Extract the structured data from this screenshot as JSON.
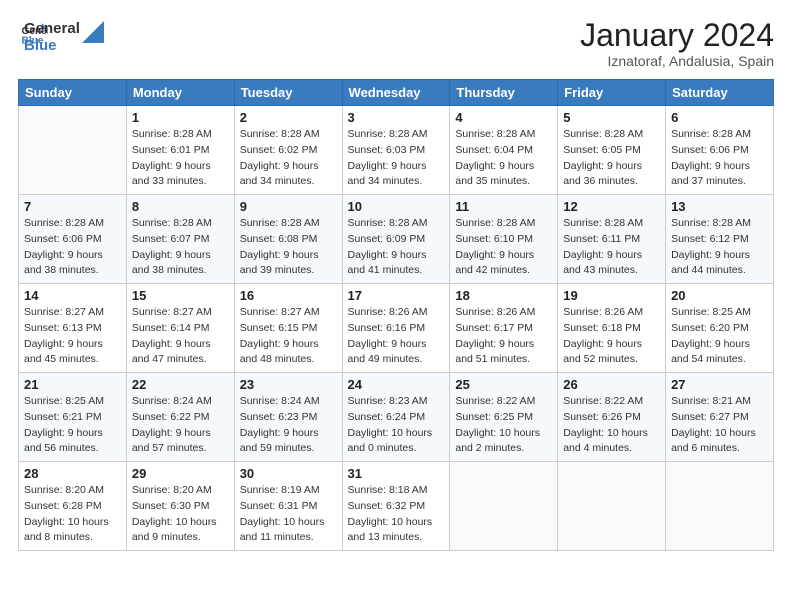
{
  "header": {
    "logo_general": "General",
    "logo_blue": "Blue",
    "month_title": "January 2024",
    "subtitle": "Iznatoraf, Andalusia, Spain"
  },
  "weekdays": [
    "Sunday",
    "Monday",
    "Tuesday",
    "Wednesday",
    "Thursday",
    "Friday",
    "Saturday"
  ],
  "weeks": [
    [
      {
        "day": "",
        "info": ""
      },
      {
        "day": "1",
        "info": "Sunrise: 8:28 AM\nSunset: 6:01 PM\nDaylight: 9 hours\nand 33 minutes."
      },
      {
        "day": "2",
        "info": "Sunrise: 8:28 AM\nSunset: 6:02 PM\nDaylight: 9 hours\nand 34 minutes."
      },
      {
        "day": "3",
        "info": "Sunrise: 8:28 AM\nSunset: 6:03 PM\nDaylight: 9 hours\nand 34 minutes."
      },
      {
        "day": "4",
        "info": "Sunrise: 8:28 AM\nSunset: 6:04 PM\nDaylight: 9 hours\nand 35 minutes."
      },
      {
        "day": "5",
        "info": "Sunrise: 8:28 AM\nSunset: 6:05 PM\nDaylight: 9 hours\nand 36 minutes."
      },
      {
        "day": "6",
        "info": "Sunrise: 8:28 AM\nSunset: 6:06 PM\nDaylight: 9 hours\nand 37 minutes."
      }
    ],
    [
      {
        "day": "7",
        "info": "Sunrise: 8:28 AM\nSunset: 6:06 PM\nDaylight: 9 hours\nand 38 minutes."
      },
      {
        "day": "8",
        "info": "Sunrise: 8:28 AM\nSunset: 6:07 PM\nDaylight: 9 hours\nand 38 minutes."
      },
      {
        "day": "9",
        "info": "Sunrise: 8:28 AM\nSunset: 6:08 PM\nDaylight: 9 hours\nand 39 minutes."
      },
      {
        "day": "10",
        "info": "Sunrise: 8:28 AM\nSunset: 6:09 PM\nDaylight: 9 hours\nand 41 minutes."
      },
      {
        "day": "11",
        "info": "Sunrise: 8:28 AM\nSunset: 6:10 PM\nDaylight: 9 hours\nand 42 minutes."
      },
      {
        "day": "12",
        "info": "Sunrise: 8:28 AM\nSunset: 6:11 PM\nDaylight: 9 hours\nand 43 minutes."
      },
      {
        "day": "13",
        "info": "Sunrise: 8:28 AM\nSunset: 6:12 PM\nDaylight: 9 hours\nand 44 minutes."
      }
    ],
    [
      {
        "day": "14",
        "info": "Sunrise: 8:27 AM\nSunset: 6:13 PM\nDaylight: 9 hours\nand 45 minutes."
      },
      {
        "day": "15",
        "info": "Sunrise: 8:27 AM\nSunset: 6:14 PM\nDaylight: 9 hours\nand 47 minutes."
      },
      {
        "day": "16",
        "info": "Sunrise: 8:27 AM\nSunset: 6:15 PM\nDaylight: 9 hours\nand 48 minutes."
      },
      {
        "day": "17",
        "info": "Sunrise: 8:26 AM\nSunset: 6:16 PM\nDaylight: 9 hours\nand 49 minutes."
      },
      {
        "day": "18",
        "info": "Sunrise: 8:26 AM\nSunset: 6:17 PM\nDaylight: 9 hours\nand 51 minutes."
      },
      {
        "day": "19",
        "info": "Sunrise: 8:26 AM\nSunset: 6:18 PM\nDaylight: 9 hours\nand 52 minutes."
      },
      {
        "day": "20",
        "info": "Sunrise: 8:25 AM\nSunset: 6:20 PM\nDaylight: 9 hours\nand 54 minutes."
      }
    ],
    [
      {
        "day": "21",
        "info": "Sunrise: 8:25 AM\nSunset: 6:21 PM\nDaylight: 9 hours\nand 56 minutes."
      },
      {
        "day": "22",
        "info": "Sunrise: 8:24 AM\nSunset: 6:22 PM\nDaylight: 9 hours\nand 57 minutes."
      },
      {
        "day": "23",
        "info": "Sunrise: 8:24 AM\nSunset: 6:23 PM\nDaylight: 9 hours\nand 59 minutes."
      },
      {
        "day": "24",
        "info": "Sunrise: 8:23 AM\nSunset: 6:24 PM\nDaylight: 10 hours\nand 0 minutes."
      },
      {
        "day": "25",
        "info": "Sunrise: 8:22 AM\nSunset: 6:25 PM\nDaylight: 10 hours\nand 2 minutes."
      },
      {
        "day": "26",
        "info": "Sunrise: 8:22 AM\nSunset: 6:26 PM\nDaylight: 10 hours\nand 4 minutes."
      },
      {
        "day": "27",
        "info": "Sunrise: 8:21 AM\nSunset: 6:27 PM\nDaylight: 10 hours\nand 6 minutes."
      }
    ],
    [
      {
        "day": "28",
        "info": "Sunrise: 8:20 AM\nSunset: 6:28 PM\nDaylight: 10 hours\nand 8 minutes."
      },
      {
        "day": "29",
        "info": "Sunrise: 8:20 AM\nSunset: 6:30 PM\nDaylight: 10 hours\nand 9 minutes."
      },
      {
        "day": "30",
        "info": "Sunrise: 8:19 AM\nSunset: 6:31 PM\nDaylight: 10 hours\nand 11 minutes."
      },
      {
        "day": "31",
        "info": "Sunrise: 8:18 AM\nSunset: 6:32 PM\nDaylight: 10 hours\nand 13 minutes."
      },
      {
        "day": "",
        "info": ""
      },
      {
        "day": "",
        "info": ""
      },
      {
        "day": "",
        "info": ""
      }
    ]
  ]
}
